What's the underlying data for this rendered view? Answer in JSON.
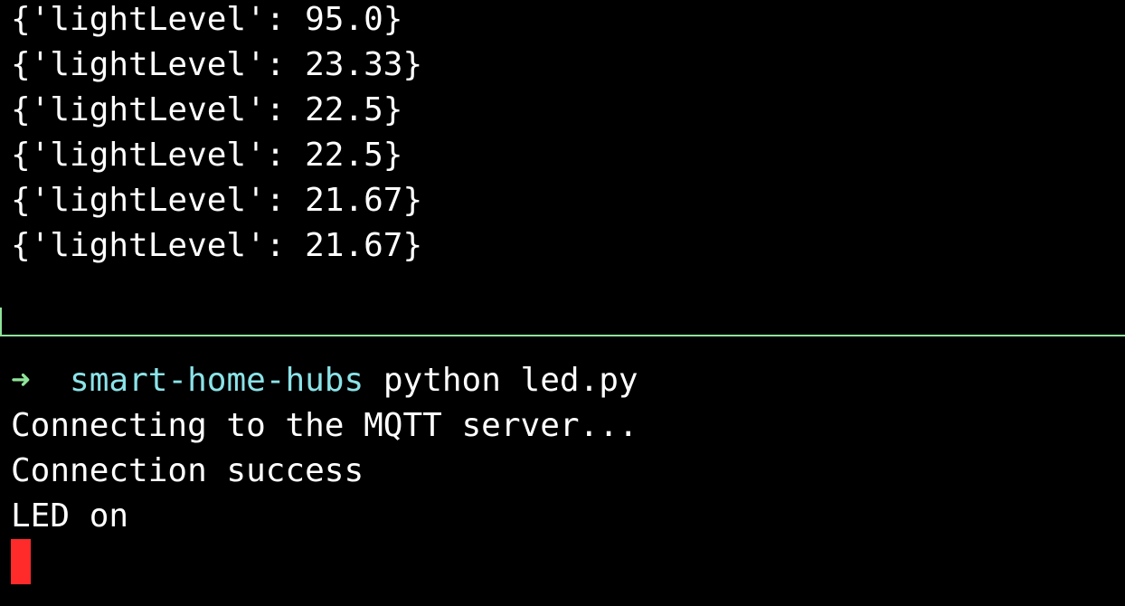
{
  "top_pane": {
    "lines": [
      "{'lightLevel': 95.0}",
      "{'lightLevel': 23.33}",
      "{'lightLevel': 22.5}",
      "{'lightLevel': 22.5}",
      "{'lightLevel': 21.67}",
      "{'lightLevel': 21.67}"
    ]
  },
  "bottom_pane": {
    "prompt": {
      "arrow": "➜",
      "directory": "smart-home-hubs",
      "command": "python led.py"
    },
    "output": [
      "Connecting to the MQTT server...",
      "Connection success",
      "LED on"
    ]
  },
  "colors": {
    "background": "#000000",
    "text": "#ffffff",
    "prompt_arrow": "#8fe39a",
    "prompt_directory": "#8be3e8",
    "divider": "#8fe39a",
    "cursor": "#ff2a2a"
  }
}
